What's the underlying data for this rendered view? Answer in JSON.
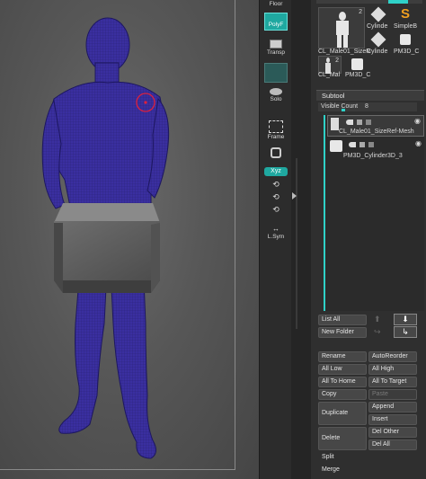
{
  "shelf": {
    "floor_label": "Floor",
    "polyf_label": "PolyF",
    "transp_label": "Transp",
    "solo_label": "Solo",
    "frame_label": "Frame",
    "lsym_label": "L.Sym",
    "xyz_label": "Xyz"
  },
  "tools": {
    "count_badge": "2",
    "items": [
      {
        "label": "CL_Male01_SizeR"
      },
      {
        "label": "Cylinde"
      },
      {
        "label": "SimpleB"
      },
      {
        "label": "Cylinde"
      },
      {
        "label": "PM3D_C"
      },
      {
        "label": "CL_Mal"
      },
      {
        "label": "PM3D_C"
      }
    ],
    "small_badge": "2"
  },
  "subtool": {
    "header": "Subtool",
    "visible_count_label": "Visible Count",
    "visible_count_value": "8",
    "items": [
      {
        "name": "CL_Male01_SizeRef-Mesh"
      },
      {
        "name": "PM3D_Cylinder3D_3"
      }
    ]
  },
  "buttons": {
    "list_all": "List All",
    "new_folder": "New Folder",
    "rename": "Rename",
    "autoreorder": "AutoReorder",
    "all_low": "All Low",
    "all_high": "All High",
    "all_to_home": "All To Home",
    "all_to_target": "All To Target",
    "copy": "Copy",
    "paste": "Paste",
    "duplicate": "Duplicate",
    "append": "Append",
    "insert": "Insert",
    "delete": "Delete",
    "del_other": "Del Other",
    "del_all": "Del All",
    "split": "Split",
    "merge": "Merge"
  },
  "colors": {
    "mesh": "#3a2fa0",
    "accent": "#2fd2c8",
    "cube": "#5e5e5e"
  }
}
